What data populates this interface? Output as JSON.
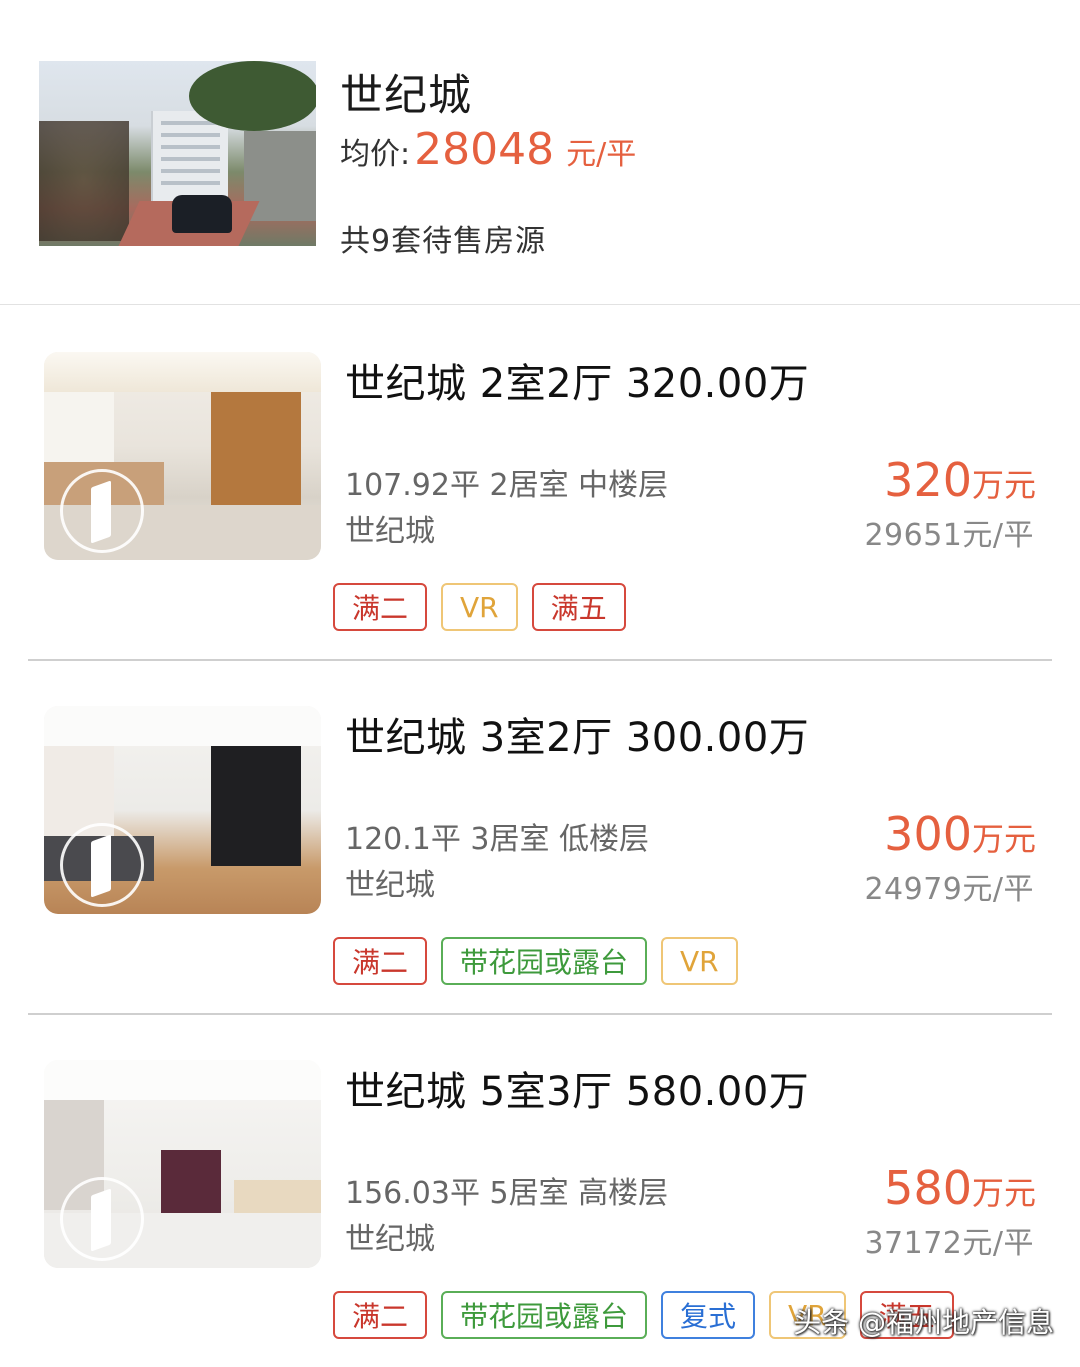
{
  "community": {
    "name": "世纪城",
    "avg_label": "均价:",
    "avg_price": "28048",
    "avg_unit": "元/平",
    "listing_count": "共9套待售房源"
  },
  "listings": [
    {
      "title": "世纪城 2室2厅 320.00万",
      "spec": "107.92平 2居室 中楼层",
      "estate": "世纪城",
      "price": "320",
      "price_unit": "万元",
      "unit_price": "29651元/平",
      "tags": [
        {
          "label": "满二",
          "color": "red"
        },
        {
          "label": "VR",
          "color": "gold"
        },
        {
          "label": "满五",
          "color": "red"
        }
      ]
    },
    {
      "title": "世纪城 3室2厅 300.00万",
      "spec": "120.1平 3居室 低楼层",
      "estate": "世纪城",
      "price": "300",
      "price_unit": "万元",
      "unit_price": "24979元/平",
      "tags": [
        {
          "label": "满二",
          "color": "red"
        },
        {
          "label": "带花园或露台",
          "color": "green"
        },
        {
          "label": "VR",
          "color": "gold"
        }
      ]
    },
    {
      "title": "世纪城 5室3厅 580.00万",
      "spec": "156.03平 5居室 高楼层",
      "estate": "世纪城",
      "price": "580",
      "price_unit": "万元",
      "unit_price": "37172元/平",
      "tags": [
        {
          "label": "满二",
          "color": "red"
        },
        {
          "label": "带花园或露台",
          "color": "green"
        },
        {
          "label": "复式",
          "color": "blue"
        },
        {
          "label": "VR",
          "color": "gold"
        },
        {
          "label": "满五",
          "color": "red"
        }
      ]
    }
  ],
  "watermark": "头条 @福州地产信息",
  "colors": {
    "price": "#e5603f",
    "tag_red": "#d6493d",
    "tag_gold": "#efc676",
    "tag_green": "#5aae57",
    "tag_blue": "#3f80de"
  },
  "icons": {
    "vr_badge": "panorama-icon"
  }
}
